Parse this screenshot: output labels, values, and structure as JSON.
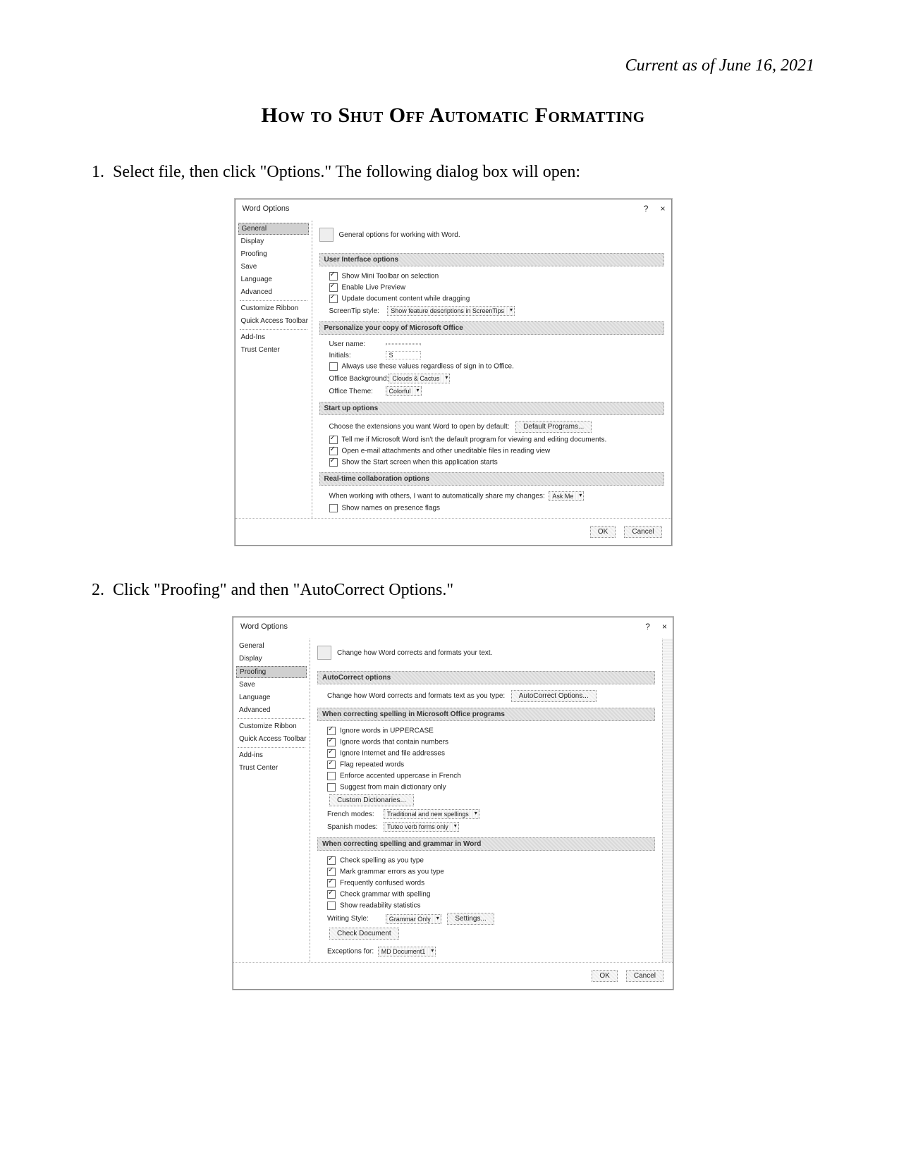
{
  "header": {
    "date": "Current as of June 16, 2021"
  },
  "title": "How to Shut Off Automatic Formatting",
  "steps": {
    "s1_num": "1.",
    "s1_text": "Select file, then click \"Options.\"  The following dialog box will open:",
    "s2_num": "2.",
    "s2_text": "Click \"Proofing\" and then \"AutoCorrect Options.\""
  },
  "dlg1": {
    "title": "Word Options",
    "help": "?",
    "close": "×",
    "sidebar": [
      "General",
      "Display",
      "Proofing",
      "Save",
      "Language",
      "Advanced",
      "Customize Ribbon",
      "Quick Access Toolbar",
      "Add-Ins",
      "Trust Center"
    ],
    "intro": "General options for working with Word.",
    "sec_ui": "User Interface options",
    "ui_opts": {
      "show_mini": "Show Mini Toolbar on selection",
      "live_preview": "Enable Live Preview",
      "update_drag": "Update document content while dragging",
      "screentip_label": "ScreenTip style:",
      "screentip_value": "Show feature descriptions in ScreenTips"
    },
    "sec_personal": "Personalize your copy of Microsoft Office",
    "personal": {
      "username_label": "User name:",
      "initials_label": "Initials:",
      "initials_value": "S",
      "always_use": "Always use these values regardless of sign in to Office.",
      "bg_label": "Office Background:",
      "bg_value": "Clouds & Cactus",
      "theme_label": "Office Theme:",
      "theme_value": "Colorful"
    },
    "sec_startup": "Start up options",
    "startup": {
      "choose_ext": "Choose the extensions you want Word to open by default:",
      "default_programs_btn": "Default Programs...",
      "tell_me": "Tell me if Microsoft Word isn't the default program for viewing and editing documents.",
      "open_email": "Open e-mail attachments and other uneditable files in reading view",
      "show_start": "Show the Start screen when this application starts"
    },
    "sec_collab": "Real-time collaboration options",
    "collab": {
      "when_working": "When working with others, I want to automatically share my changes:",
      "when_working_value": "Ask Me",
      "show_names": "Show names on presence flags"
    },
    "ok": "OK",
    "cancel": "Cancel"
  },
  "dlg2": {
    "title": "Word Options",
    "help": "?",
    "close": "×",
    "sidebar": [
      "General",
      "Display",
      "Proofing",
      "Save",
      "Language",
      "Advanced",
      "Customize Ribbon",
      "Quick Access Toolbar",
      "Add-ins",
      "Trust Center"
    ],
    "intro": "Change how Word corrects and formats your text.",
    "sec_ac": "AutoCorrect options",
    "ac_line": "Change how Word corrects and formats text as you type:",
    "ac_btn": "AutoCorrect Options...",
    "sec_spell_office": "When correcting spelling in Microsoft Office programs",
    "spell_office": {
      "ignore_upper": "Ignore words in UPPERCASE",
      "ignore_numbers": "Ignore words that contain numbers",
      "ignore_internet": "Ignore Internet and file addresses",
      "flag_repeated": "Flag repeated words",
      "enforce_french": "Enforce accented uppercase in French",
      "suggest_main": "Suggest from main dictionary only",
      "custom_dict_btn": "Custom Dictionaries...",
      "french_label": "French modes:",
      "french_value": "Traditional and new spellings",
      "spanish_label": "Spanish modes:",
      "spanish_value": "Tuteo verb forms only"
    },
    "sec_spell_word": "When correcting spelling and grammar in Word",
    "spell_word": {
      "check_spelling": "Check spelling as you type",
      "mark_grammar": "Mark grammar errors as you type",
      "freq_confused": "Frequently confused words",
      "check_grammar_with": "Check grammar with spelling",
      "show_readability": "Show readability statistics",
      "writing_style_label": "Writing Style:",
      "writing_style_value": "Grammar Only",
      "settings_btn": "Settings...",
      "check_doc_btn": "Check Document"
    },
    "exceptions_label": "Exceptions for:",
    "exceptions_value": "MD Document1",
    "ok": "OK",
    "cancel": "Cancel"
  }
}
